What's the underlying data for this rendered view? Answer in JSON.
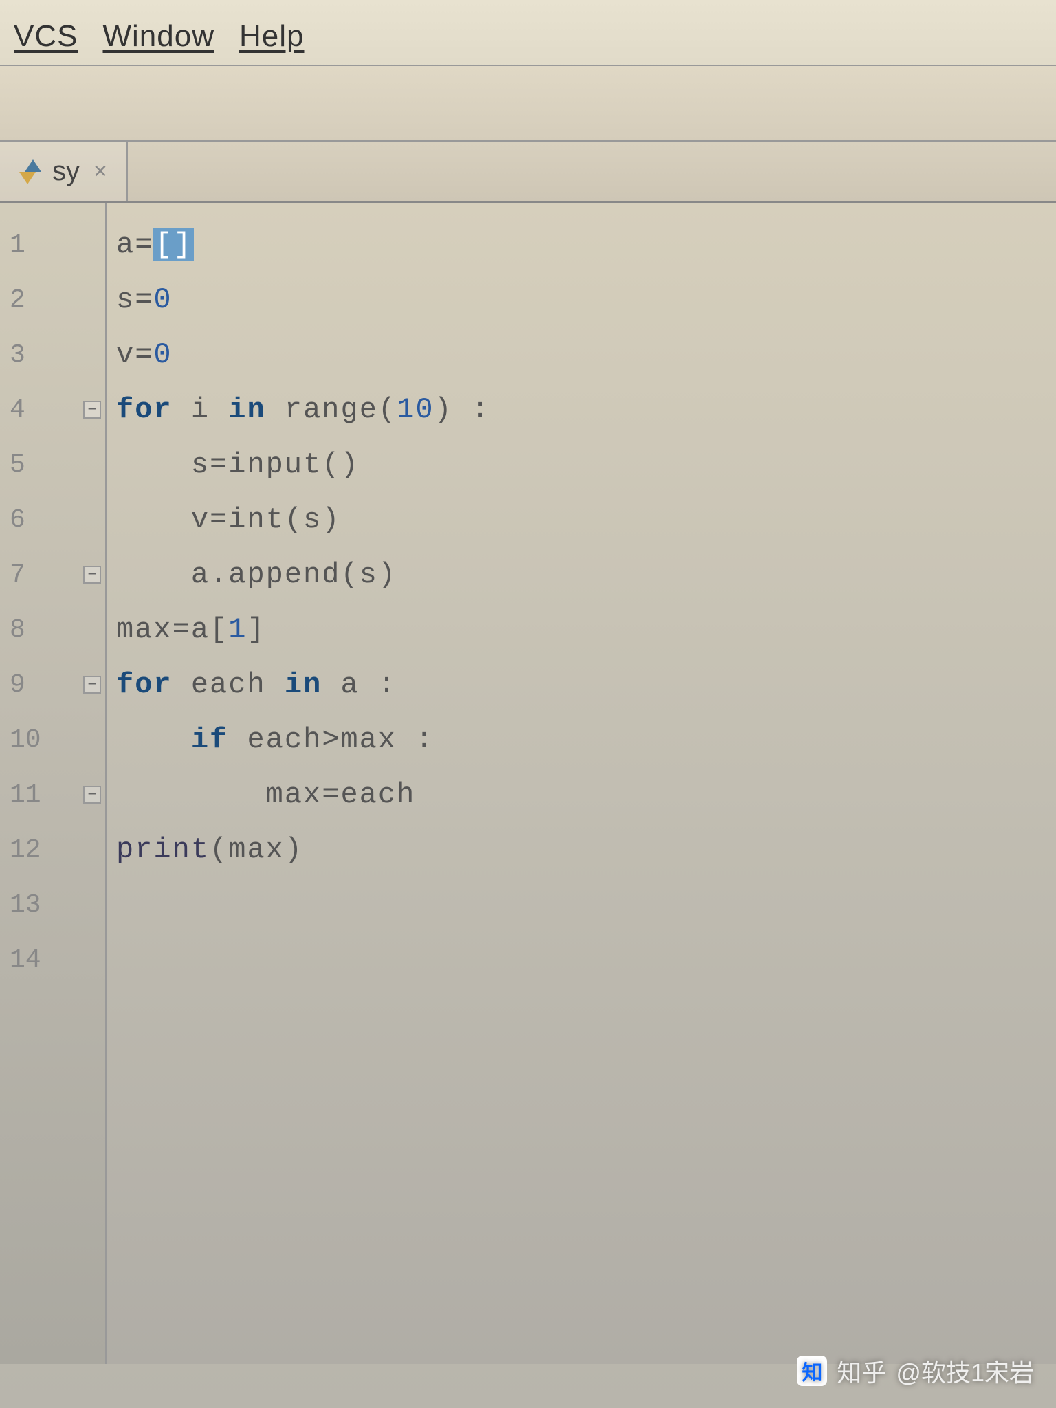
{
  "menubar": {
    "items": [
      {
        "label": "VCS"
      },
      {
        "label": "Window"
      },
      {
        "label": "Help"
      }
    ]
  },
  "tab": {
    "label": "sy",
    "close": "×"
  },
  "gutter": {
    "lines": [
      "1",
      "2",
      "3",
      "4",
      "5",
      "6",
      "7",
      "8",
      "9",
      "10",
      "11",
      "12",
      "13",
      "14"
    ]
  },
  "code": {
    "lines": [
      {
        "indent": 0,
        "tokens": [
          {
            "t": "a=",
            "c": "p"
          },
          {
            "t": "[]",
            "c": "hl"
          }
        ]
      },
      {
        "indent": 0,
        "tokens": [
          {
            "t": "s=",
            "c": "p"
          },
          {
            "t": "0",
            "c": "num"
          }
        ]
      },
      {
        "indent": 0,
        "tokens": [
          {
            "t": "v=",
            "c": "p"
          },
          {
            "t": "0",
            "c": "num"
          }
        ]
      },
      {
        "indent": 0,
        "tokens": [
          {
            "t": "for",
            "c": "kw"
          },
          {
            "t": " i ",
            "c": "p"
          },
          {
            "t": "in",
            "c": "kw"
          },
          {
            "t": " range(",
            "c": "p"
          },
          {
            "t": "10",
            "c": "num"
          },
          {
            "t": ") :",
            "c": "p"
          }
        ],
        "fold": true
      },
      {
        "indent": 1,
        "tokens": [
          {
            "t": "s=input()",
            "c": "p"
          }
        ]
      },
      {
        "indent": 1,
        "tokens": [
          {
            "t": "v=int(s)",
            "c": "p"
          }
        ]
      },
      {
        "indent": 1,
        "tokens": [
          {
            "t": "a.append(s)",
            "c": "p"
          }
        ],
        "fold": true
      },
      {
        "indent": 0,
        "tokens": [
          {
            "t": "max=a[",
            "c": "p"
          },
          {
            "t": "1",
            "c": "num"
          },
          {
            "t": "]",
            "c": "p"
          }
        ]
      },
      {
        "indent": 0,
        "tokens": [
          {
            "t": "for",
            "c": "kw"
          },
          {
            "t": " each ",
            "c": "p"
          },
          {
            "t": "in",
            "c": "kw"
          },
          {
            "t": " a :",
            "c": "p"
          }
        ],
        "fold": true
      },
      {
        "indent": 1,
        "tokens": [
          {
            "t": "if",
            "c": "kw"
          },
          {
            "t": " each>max :",
            "c": "p"
          }
        ]
      },
      {
        "indent": 2,
        "tokens": [
          {
            "t": "max=each",
            "c": "p"
          }
        ],
        "fold": true
      },
      {
        "indent": 0,
        "tokens": [
          {
            "t": "print",
            "c": "builtin"
          },
          {
            "t": "(max)",
            "c": "p"
          }
        ]
      },
      {
        "indent": 0,
        "tokens": []
      },
      {
        "indent": 0,
        "tokens": []
      }
    ]
  },
  "watermark": {
    "site": "知乎",
    "author": "@软技1宋岩",
    "icon": "知"
  }
}
